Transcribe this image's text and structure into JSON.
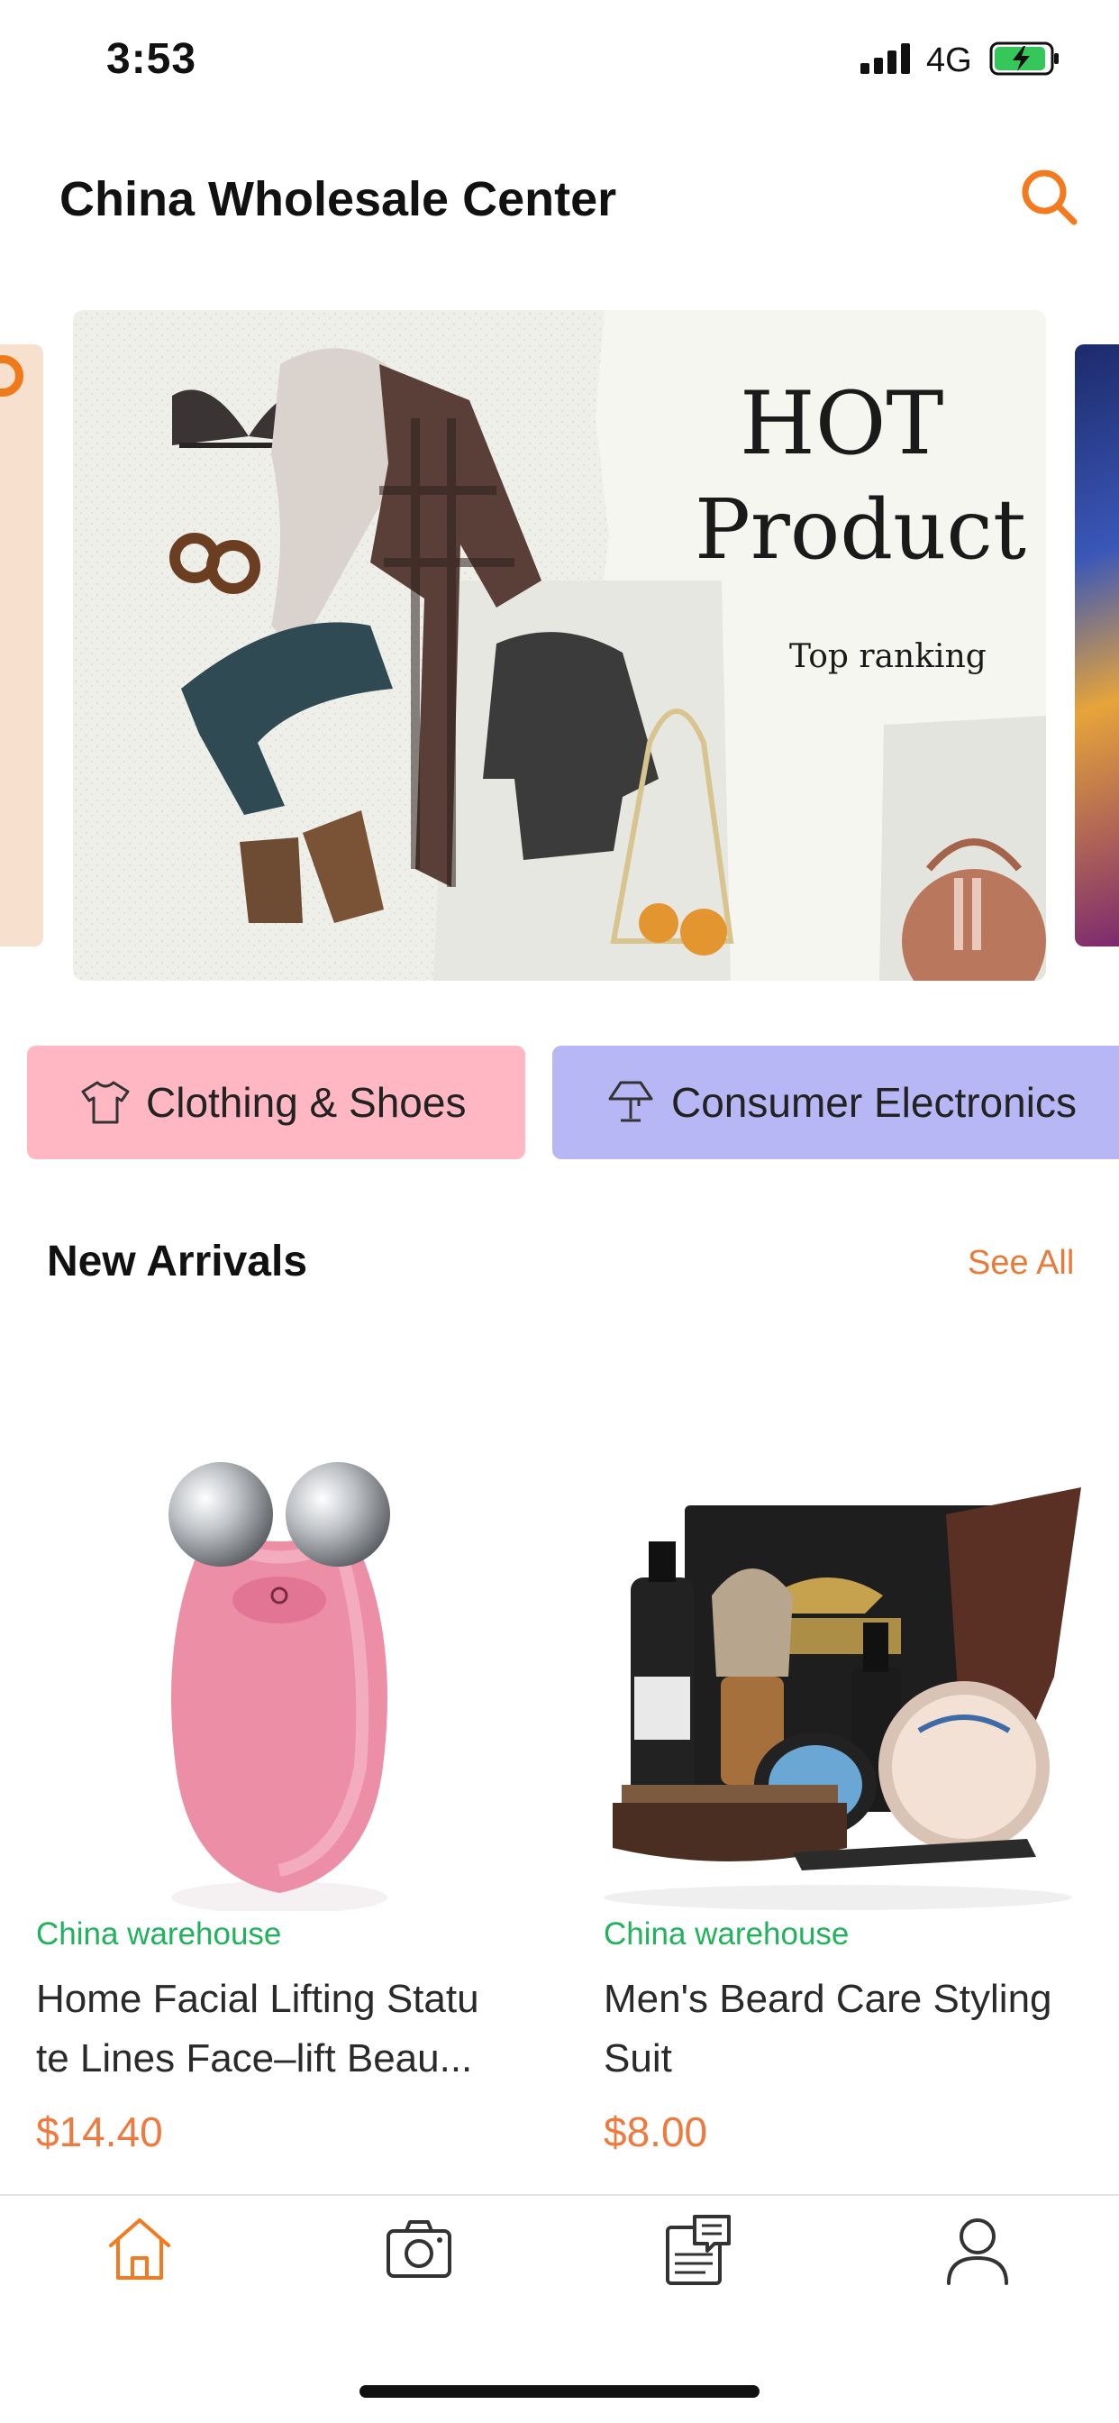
{
  "status_bar": {
    "time": "3:53",
    "network": "4G",
    "battery_icon": "battery-charging-icon",
    "signal_icon": "signal-bars-icon"
  },
  "header": {
    "title": "China Wholesale Center",
    "search_icon": "search-icon",
    "accent_color": "#F47A20"
  },
  "banner": {
    "line1": "HOT",
    "line2": "Product",
    "line3": "Top ranking"
  },
  "categories": [
    {
      "label": "Clothing & Shoes",
      "icon": "tshirt-icon",
      "color": "#FFB8C3"
    },
    {
      "label": "Consumer Electronics",
      "icon": "lamp-icon",
      "color": "#B6B7F4"
    }
  ],
  "new_arrivals": {
    "title": "New Arrivals",
    "see_all": "See All"
  },
  "products": [
    {
      "warehouse": "China warehouse",
      "name": "Home Facial Lifting Statu te Lines Face–lift Beau...",
      "price": "$14.40"
    },
    {
      "warehouse": "China warehouse",
      "name": "Men's Beard Care Styling Suit",
      "price": "$8.00"
    }
  ],
  "tab_bar": {
    "active_color": "#F47A20",
    "tabs": [
      {
        "icon": "home-icon",
        "active": true
      },
      {
        "icon": "camera-icon",
        "active": false
      },
      {
        "icon": "orders-icon",
        "active": false
      },
      {
        "icon": "profile-icon",
        "active": false
      }
    ]
  }
}
